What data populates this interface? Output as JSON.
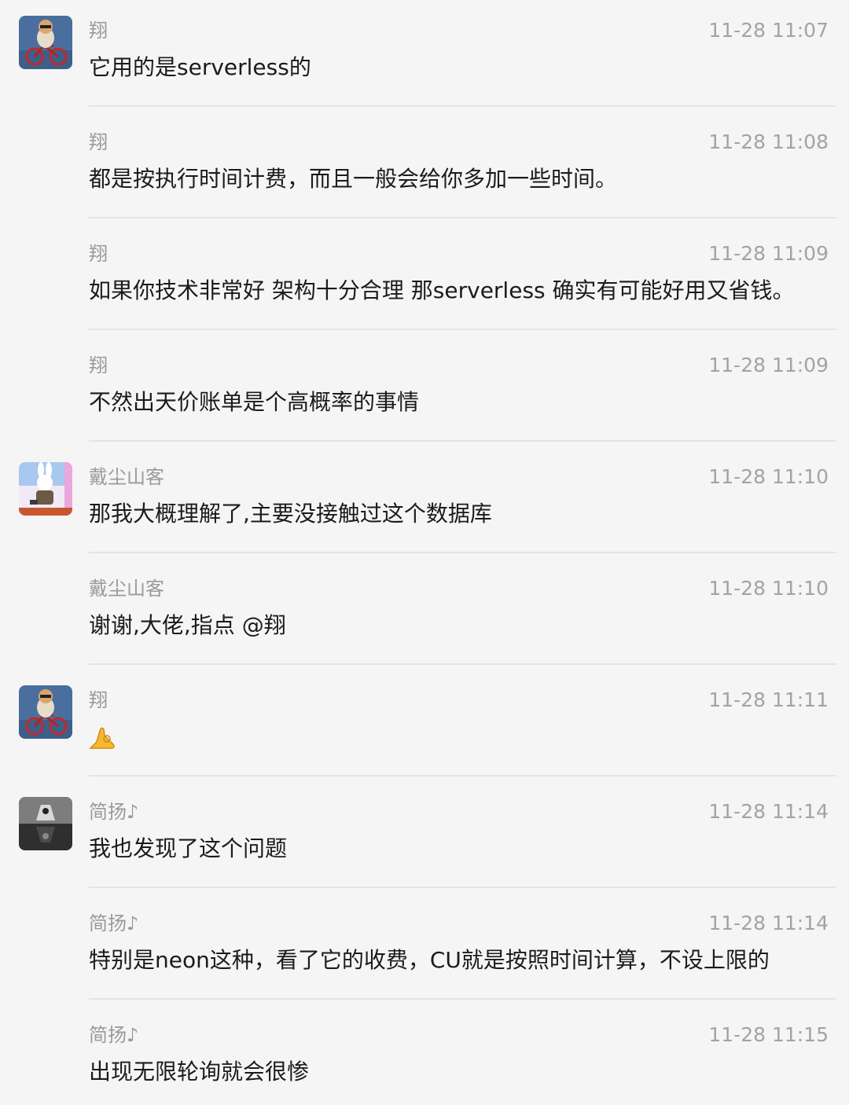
{
  "messages": [
    {
      "sender": "翔",
      "time": "11-28 11:07",
      "text": "它用的是serverless的"
    },
    {
      "sender": "翔",
      "time": "11-28 11:08",
      "text": "都是按执行时间计费，而且一般会给你多加一些时间。"
    },
    {
      "sender": "翔",
      "time": "11-28 11:09",
      "text": "如果你技术非常好 架构十分合理  那serverless 确实有可能好用又省钱。"
    },
    {
      "sender": "翔",
      "time": "11-28 11:09",
      "text": "不然出天价账单是个高概率的事情"
    },
    {
      "sender": "戴尘山客",
      "time": "11-28 11:10",
      "text": "那我大概理解了,主要没接触过这个数据库"
    },
    {
      "sender": "戴尘山客",
      "time": "11-28 11:10",
      "text": "谢谢,大佬,指点  @翔"
    },
    {
      "sender": "翔",
      "time": "11-28 11:11",
      "emoji": "ok-hand-emoji"
    },
    {
      "sender": "简扬♪",
      "time": "11-28 11:14",
      "text": "我也发现了这个问题"
    },
    {
      "sender": "简扬♪",
      "time": "11-28 11:14",
      "text": "特别是neon这种，看了它的收费，CU就是按照时间计算，不设上限的"
    },
    {
      "sender": "简扬♪",
      "time": "11-28 11:15",
      "text": "出现无限轮询就会很惨"
    }
  ],
  "colors": {
    "background": "#f5f5f5",
    "sender": "#9a9a9a",
    "time": "#a3a3a3",
    "text": "#1b1b1b",
    "divider": "#e4e4e4"
  }
}
